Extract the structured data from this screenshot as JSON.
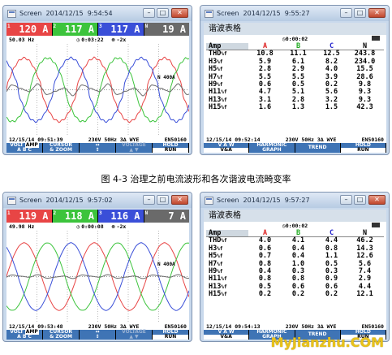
{
  "caption": "图 4-3 治理之前电流波形和各次谐波电流畸变率",
  "watermark": "MyJianzhu.COM",
  "common": {
    "config": "230V 50Hz 3∆ WYE",
    "model": "EN50160",
    "date": "12/15/14",
    "colors": {
      "L1": "#e84545",
      "L2": "#3cc43c",
      "L3": "#3a4fd8",
      "N": "#6a6a6a",
      "softkey": "#3f74b5"
    }
  },
  "waveform_softkeys": [
    {
      "top": "VOLT",
      "topHL": "AMP",
      "bottom": "A B C"
    },
    {
      "top": "CURSOR",
      "bottom": "& ZOOM"
    },
    {
      "top": "↔",
      "bottom": "↕"
    },
    {
      "top": "VOLTAGE",
      "bottom": "▲ ▼",
      "dim": true
    },
    {
      "top": "HOLD",
      "bottom": "RUN"
    }
  ],
  "harmonic_softkeys": [
    {
      "top": "V A W",
      "bottom": "V&A"
    },
    {
      "top": "HARMONIC",
      "bottom": "GRAPH"
    },
    {
      "top": "TREND",
      "bottom": ""
    },
    {
      "top": "HOLD",
      "bottom": "RUN"
    }
  ],
  "harmonic_title": "谐波表格",
  "harmonic_header": [
    "Amp",
    "A",
    "B",
    "C",
    "N"
  ],
  "harmonic_labels": [
    "THD",
    "H3",
    "H5",
    "H7",
    "H9",
    "H11",
    "H13",
    "H15"
  ],
  "harmonic_suffix": "%f",
  "windows": [
    {
      "kind": "waveform",
      "title": "Screen",
      "timestamp": "2014/12/15  9:54:54",
      "chips": [
        {
          "ch": "1",
          "value": "120 A",
          "color": "#e84545"
        },
        {
          "ch": "2",
          "value": "117 A",
          "color": "#3cc43c"
        },
        {
          "ch": "3",
          "value": "117 A",
          "color": "#3a4fd8"
        },
        {
          "ch": "N",
          "value": "19 A",
          "color": "#6a6a6a"
        }
      ],
      "freq": "50.03 Hz",
      "elapsed": "0:03:22",
      "zoom": "-2x",
      "time": "09:51:39",
      "nlabel": "N 400A",
      "chart_data": {
        "type": "line",
        "series": [
          {
            "name": "A",
            "phase": 0,
            "distort": 0.35
          },
          {
            "name": "B",
            "phase": 120,
            "distort": 0.35
          },
          {
            "name": "C",
            "phase": 240,
            "distort": 0.35
          },
          {
            "name": "N",
            "phase": 30,
            "distort": 0.6,
            "amp": 0.18
          }
        ]
      }
    },
    {
      "kind": "harmonic",
      "title": "Screen",
      "timestamp": "2014/12/15  9:55:27",
      "elapsed": "0:00:02",
      "time": "09:52:14",
      "rows": [
        [
          "10.8",
          "11.1",
          "12.5",
          "243.8"
        ],
        [
          "5.9",
          "6.1",
          "8.2",
          "234.0"
        ],
        [
          "2.8",
          "2.9",
          "4.0",
          "15.5"
        ],
        [
          "5.5",
          "5.5",
          "3.9",
          "28.6"
        ],
        [
          "0.6",
          "0.5",
          "0.2",
          "9.8"
        ],
        [
          "4.7",
          "5.1",
          "5.6",
          "9.3"
        ],
        [
          "3.1",
          "2.8",
          "3.2",
          "9.3"
        ],
        [
          "1.6",
          "1.3",
          "1.5",
          "42.3"
        ]
      ]
    },
    {
      "kind": "waveform",
      "title": "Screen",
      "timestamp": "2014/12/15  9:57:02",
      "chips": [
        {
          "ch": "1",
          "value": "119 A",
          "color": "#e84545"
        },
        {
          "ch": "2",
          "value": "118 A",
          "color": "#3cc43c"
        },
        {
          "ch": "3",
          "value": "116 A",
          "color": "#3a4fd8"
        },
        {
          "ch": "N",
          "value": "7 A",
          "color": "#6a6a6a"
        }
      ],
      "freq": "49.98 Hz",
      "elapsed": "0:00:08",
      "zoom": "-2x",
      "time": "09:53:48",
      "nlabel": "N 400A",
      "chart_data": {
        "type": "line",
        "series": [
          {
            "name": "A",
            "phase": 0,
            "distort": 0.05
          },
          {
            "name": "B",
            "phase": 120,
            "distort": 0.05
          },
          {
            "name": "C",
            "phase": 240,
            "distort": 0.05
          },
          {
            "name": "N",
            "phase": 30,
            "distort": 0.1,
            "amp": 0.06
          }
        ]
      }
    },
    {
      "kind": "harmonic",
      "title": "Screen",
      "timestamp": "2014/12/15  9:57:27",
      "elapsed": "0:00:02",
      "time": "09:54:13",
      "rows": [
        [
          "4.0",
          "4.1",
          "4.4",
          "46.2"
        ],
        [
          "0.6",
          "0.4",
          "0.8",
          "14.3"
        ],
        [
          "0.7",
          "0.4",
          "1.1",
          "12.6"
        ],
        [
          "0.8",
          "1.0",
          "0.5",
          "5.6"
        ],
        [
          "0.4",
          "0.3",
          "0.3",
          "7.4"
        ],
        [
          "0.8",
          "0.8",
          "0.9",
          "2.9"
        ],
        [
          "0.5",
          "0.6",
          "0.6",
          "4.4"
        ],
        [
          "0.2",
          "0.2",
          "0.2",
          "12.1"
        ]
      ]
    }
  ]
}
